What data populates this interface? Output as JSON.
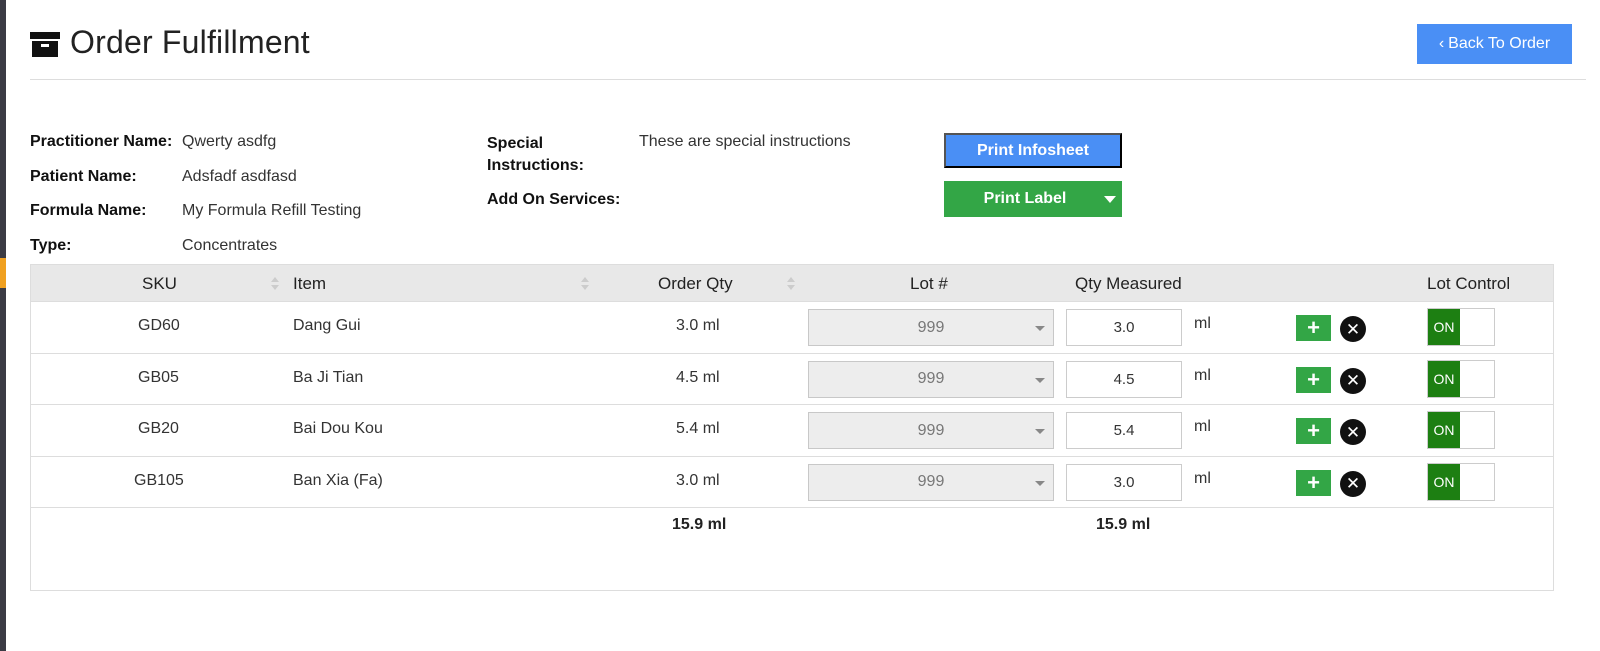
{
  "header": {
    "title": "Order Fulfillment",
    "title_icon": "archive-icon",
    "back_label": "Back To Order"
  },
  "info": {
    "practitioner_label": "Practitioner Name:",
    "practitioner_value": "Qwerty asdfg",
    "patient_label": "Patient Name:",
    "patient_value": "Adsfadf asdfasd",
    "formula_label": "Formula Name:",
    "formula_value": "My Formula Refill Testing",
    "type_label": "Type:",
    "type_value": "Concentrates",
    "special_label_line1": "Special",
    "special_label_line2": "Instructions:",
    "special_value": "These are special instructions",
    "addon_label": "Add On Services:"
  },
  "actions": {
    "print_infosheet": "Print Infosheet",
    "print_label": "Print Label"
  },
  "table": {
    "columns": [
      "SKU",
      "Item",
      "Order Qty",
      "Lot #",
      "Qty Measured",
      "Lot Control"
    ],
    "rows": [
      {
        "sku": "GD60",
        "item": "Dang Gui",
        "order_qty": "3.0 ml",
        "lot": "999",
        "qty_measured": "3.0",
        "unit": "ml",
        "lot_control": "ON"
      },
      {
        "sku": "GB05",
        "item": "Ba Ji Tian",
        "order_qty": "4.5 ml",
        "lot": "999",
        "qty_measured": "4.5",
        "unit": "ml",
        "lot_control": "ON"
      },
      {
        "sku": "GB20",
        "item": "Bai Dou Kou",
        "order_qty": "5.4 ml",
        "lot": "999",
        "qty_measured": "5.4",
        "unit": "ml",
        "lot_control": "ON"
      },
      {
        "sku": "GB105",
        "item": "Ban Xia (Fa)",
        "order_qty": "3.0 ml",
        "lot": "999",
        "qty_measured": "3.0",
        "unit": "ml",
        "lot_control": "ON"
      }
    ],
    "total_order_qty": "15.9 ml",
    "total_measured": "15.9 ml"
  },
  "colors": {
    "primary": "#4a8ff5",
    "success": "#33a646",
    "toggle_on": "#1d7f12"
  }
}
